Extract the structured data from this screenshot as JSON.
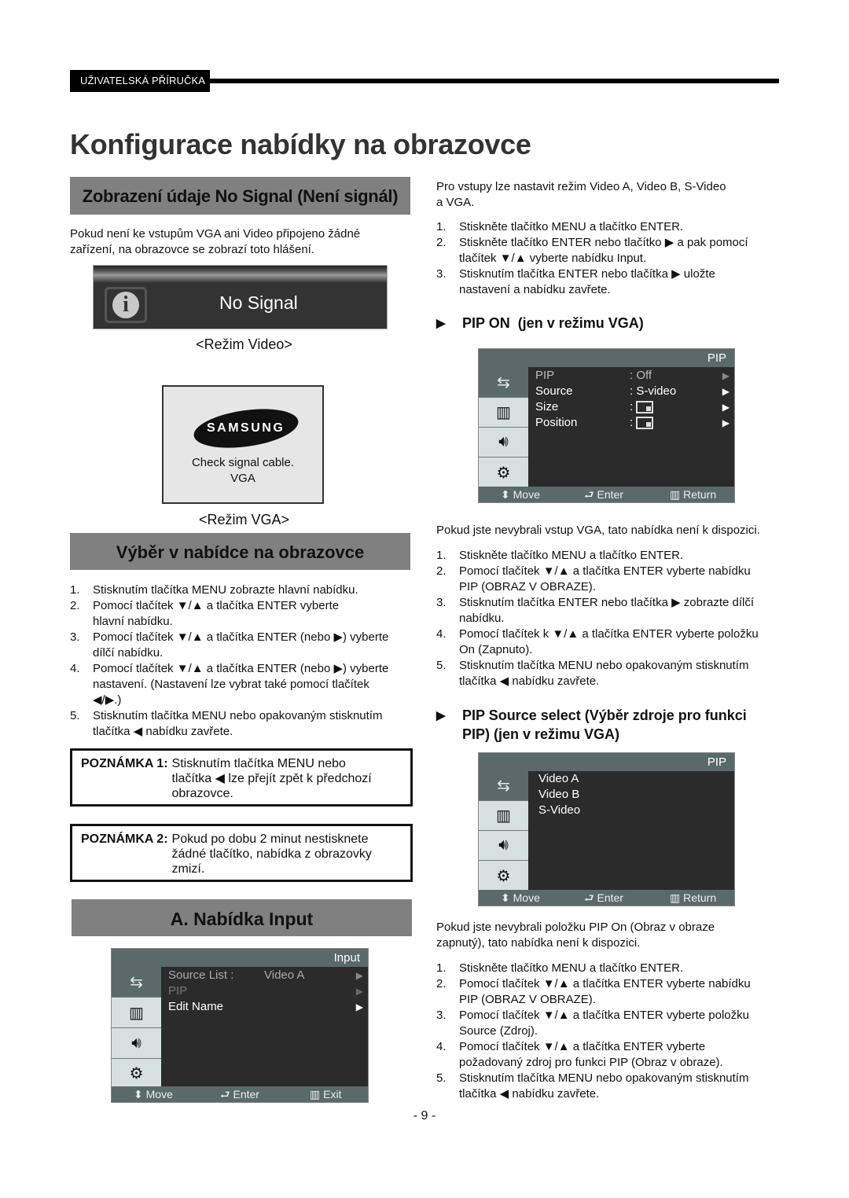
{
  "header": {
    "tab_label": "UŽIVATELSKÁ PŘÍRUČKA"
  },
  "page_title": "Konfigurace nabídky na obrazovce",
  "left": {
    "no_signal_section": {
      "heading": "Zobrazení údaje No Signal (Není signál)",
      "intro_line1": "Pokud není ke vstupům VGA ani Video připojeno žádné",
      "intro_line2": "zařízení, na obrazovce se zobrazí toto hlášení.",
      "video_box": {
        "icon": "info-icon",
        "icon_glyph": "i",
        "text": "No Signal"
      },
      "video_caption": "<Režim Video>",
      "vga_box": {
        "logo": "SAMSUNG",
        "line1": "Check signal cable.",
        "line2": "VGA"
      },
      "vga_caption": "<Režim VGA>"
    },
    "osd_section": {
      "heading": "Výběr v nabídce na obrazovce",
      "steps": [
        {
          "n": "1.",
          "lines": [
            "Stisknutím tlačítka MENU zobrazte hlavní nabídku."
          ]
        },
        {
          "n": "2.",
          "lines": [
            "Pomocí tlačítek ▼/▲ a tlačítka ENTER vyberte",
            "hlavní nabídku."
          ]
        },
        {
          "n": "3.",
          "lines": [
            "Pomocí tlačítek ▼/▲ a tlačítka ENTER (nebo ▶) vyberte",
            "dílčí nabídku."
          ]
        },
        {
          "n": "4.",
          "lines": [
            "Pomocí tlačítek ▼/▲ a tlačítka ENTER (nebo ▶) vyberte",
            "nastavení. (Nastavení lze vybrat také pomocí tlačítek",
            "◀/▶.)"
          ]
        },
        {
          "n": "5.",
          "lines": [
            "Stisknutím tlačítka MENU nebo opakovaným stisknutím",
            "tlačítka ◀ nabídku zavřete."
          ]
        }
      ],
      "note1": {
        "label": "POZNÁMKA 1:",
        "lines": [
          "Stisknutím tlačítka MENU nebo",
          "tlačítka ◀ lze přejít zpět k předchozí",
          "obrazovce."
        ]
      },
      "note2": {
        "label": "POZNÁMKA 2:",
        "lines": [
          "Pokud po dobu 2 minut nestisknete",
          "žádné tlačítko, nabídka z obrazovky",
          "zmizí."
        ]
      }
    },
    "input_section": {
      "heading": "A. Nabídka Input",
      "menu": {
        "title": "Input",
        "rows": [
          {
            "label": "Source List :",
            "value": "Video A",
            "arrow": "▶",
            "dim": false,
            "muted": true
          },
          {
            "label": "PIP",
            "value": "",
            "arrow": "▶",
            "dim": true
          },
          {
            "label": "Edit Name",
            "value": "",
            "arrow": "▶",
            "dim": false
          }
        ],
        "footer": {
          "move": "Move",
          "enter": "Enter",
          "exit": "Exit"
        }
      }
    }
  },
  "right": {
    "intro_line1": "Pro vstupy lze nastavit režim Video A, Video B, S-Video",
    "intro_line2": "a VGA.",
    "steps": [
      {
        "n": "1.",
        "lines": [
          "Stiskněte tlačítko MENU a tlačítko ENTER."
        ]
      },
      {
        "n": "2.",
        "lines": [
          "Stiskněte tlačítko ENTER nebo tlačítko ▶ a pak pomocí",
          "tlačítek ▼/▲ vyberte nabídku Input."
        ]
      },
      {
        "n": "3.",
        "lines": [
          "Stisknutím tlačítka ENTER nebo tlačítka ▶ uložte",
          "nastavení a nabídku zavřete."
        ]
      }
    ],
    "pip_on": {
      "heading": "PIP ON  (jen v režimu VGA)",
      "menu": {
        "title": "PIP",
        "rows": [
          {
            "label": "PIP",
            "value": ": Off",
            "arrow": "▶",
            "dim": true
          },
          {
            "label": "Source",
            "value": ": S-video",
            "arrow": "▶"
          },
          {
            "label": "Size",
            "value": ":",
            "arrow": "▶",
            "box": true
          },
          {
            "label": "Position",
            "value": ":",
            "arrow": "▶",
            "box": true
          }
        ],
        "footer": {
          "move": "Move",
          "enter": "Enter",
          "return": "Return"
        }
      },
      "note": "Pokud jste nevybrali vstup VGA, tato nabídka není k dispozici.",
      "steps": [
        {
          "n": "1.",
          "lines": [
            "Stiskněte tlačítko MENU a tlačítko ENTER."
          ]
        },
        {
          "n": "2.",
          "lines": [
            "Pomocí tlačítek ▼/▲ a tlačítka ENTER vyberte nabídku",
            "PIP (OBRAZ V OBRAZE)."
          ]
        },
        {
          "n": "3.",
          "lines": [
            "Stisknutím tlačítka ENTER nebo tlačítka ▶ zobrazte dílčí",
            "nabídku."
          ]
        },
        {
          "n": "4.",
          "lines": [
            "Pomocí tlačítek k ▼/▲ a tlačítka ENTER vyberte položku",
            "On (Zapnuto)."
          ]
        },
        {
          "n": "5.",
          "lines": [
            "Stisknutím tlačítka MENU nebo opakovaným stisknutím",
            "tlačítka ◀ nabídku zavřete."
          ]
        }
      ]
    },
    "pip_source": {
      "heading_line1": "PIP Source select (Výběr zdroje pro funkci",
      "heading_line2": "PIP) (jen v režimu VGA)",
      "menu": {
        "title": "PIP",
        "rows": [
          {
            "label": "Video A"
          },
          {
            "label": "Video B"
          },
          {
            "label": "S-Video"
          }
        ],
        "footer": {
          "move": "Move",
          "enter": "Enter",
          "return": "Return"
        }
      },
      "note_line1": "Pokud jste nevybrali položku PIP On (Obraz v obraze",
      "note_line2": "zapnutý), tato nabídka není k dispozici.",
      "steps": [
        {
          "n": "1.",
          "lines": [
            "Stiskněte tlačítko MENU a tlačítko ENTER."
          ]
        },
        {
          "n": "2.",
          "lines": [
            "Pomocí tlačítek ▼/▲ a tlačítka ENTER vyberte nabídku",
            "PIP (OBRAZ V OBRAZE)."
          ]
        },
        {
          "n": "3.",
          "lines": [
            "Pomocí tlačítek ▼/▲ a tlačítka ENTER vyberte položku",
            "Source (Zdroj)."
          ]
        },
        {
          "n": "4.",
          "lines": [
            "Pomocí tlačítek ▼/▲ a tlačítka ENTER vyberte",
            "požadovaný zdroj pro funkci PIP (Obraz v obraze)."
          ]
        },
        {
          "n": "5.",
          "lines": [
            "Stisknutím tlačítka MENU nebo opakovaným stisknutím",
            "tlačítka ◀ nabídku zavřete."
          ]
        }
      ]
    }
  },
  "osd_icons": [
    "input-icon",
    "picture-icon",
    "sound-icon",
    "setup-icon"
  ],
  "page_number": "- 9 -",
  "colors": {
    "osd_title_bar": "#5a6a6a",
    "osd_body": "#2b2b2b",
    "osd_sidebar": "#d6e0e0",
    "section_bar": "#808080"
  }
}
